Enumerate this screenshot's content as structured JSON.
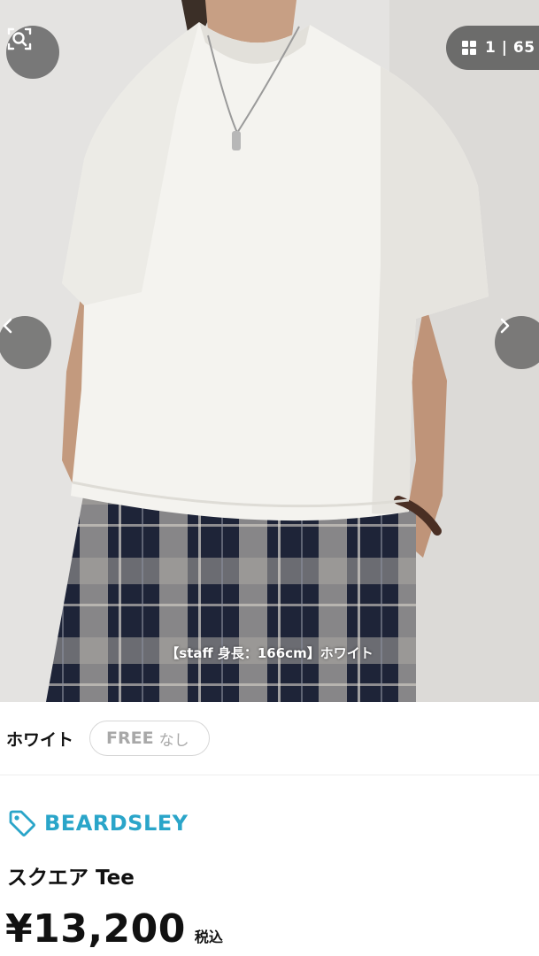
{
  "gallery": {
    "counter": "1 | 65",
    "caption": "【staff 身長：166cm】ホワイト"
  },
  "icons": {
    "zoom": "zoom-search-icon",
    "grid": "grid-icon",
    "prev": "chevron-left-icon",
    "next": "chevron-right-icon",
    "brand": "tag-icon"
  },
  "variant": {
    "color": "ホワイト",
    "size": "FREE",
    "stock": "なし"
  },
  "product": {
    "brand": "BEARDSLEY",
    "name": "スクエア Tee",
    "price": "¥13,200",
    "tax_label": "税込"
  },
  "colors": {
    "brand_accent": "#2aa5c9",
    "chip_border": "#d7d7d7",
    "overlay_button": "#5a5a5a"
  }
}
